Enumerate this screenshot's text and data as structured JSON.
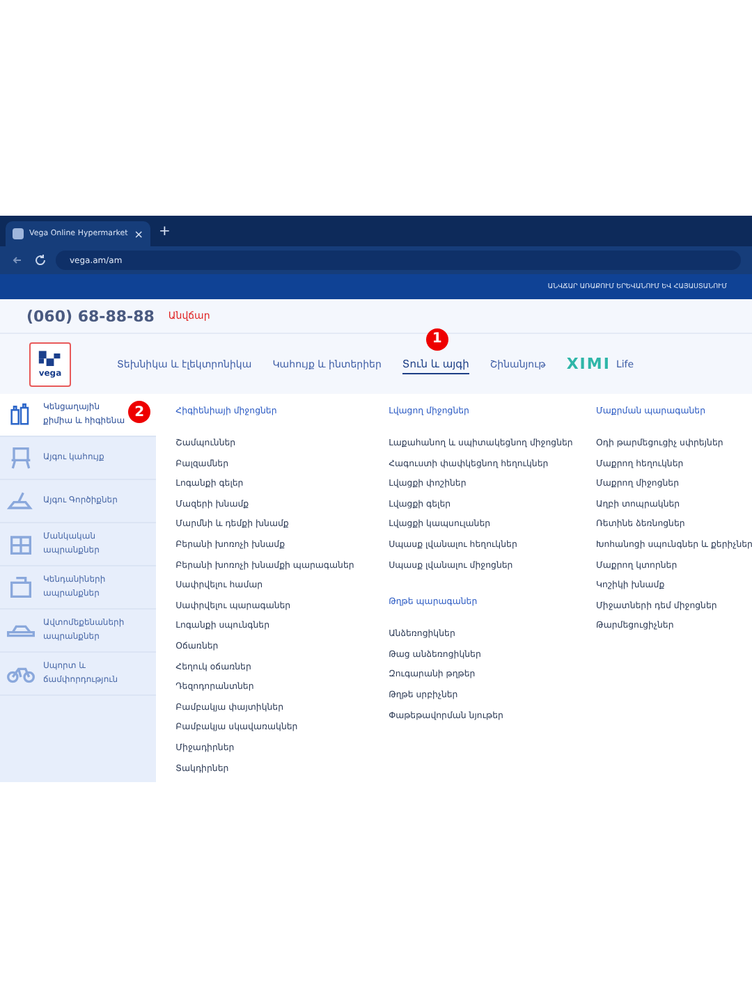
{
  "browser": {
    "tab_title": "Vega Online Hypermarket",
    "new_tab": "+",
    "close": "×",
    "url": "vega.am/am"
  },
  "promo_bar": "ԱՆՎՃԱՐ ԱՌԱՔՈՒՄ ԵՐԵՎԱՆՈՒՄ ԵՎ ՀԱՅԱՍՏԱՆՈՒՄ",
  "header": {
    "phone": "(060) 68-88-88",
    "phone_note": "Անվճար"
  },
  "logo": "vega",
  "nav": [
    {
      "label": "Տեխնիկա և էլեկտրոնիկա",
      "selected": false
    },
    {
      "label": "Կահույք և ինտերիեր",
      "selected": false
    },
    {
      "label": "Տուն և այգի",
      "selected": true,
      "marker": "1"
    },
    {
      "label": "Շինանյութ",
      "selected": false
    },
    {
      "label": "Life",
      "selected": false,
      "brand": "XIMI"
    }
  ],
  "sidebar": [
    {
      "label": "Կենցաղային քիմիա և հիգիենա",
      "selected": true,
      "marker": "2"
    },
    {
      "label": "Այգու կահույք",
      "selected": false
    },
    {
      "label": "Այգու Գործիքներ",
      "selected": false
    },
    {
      "label": "Մանկական ապրանքներ",
      "selected": false
    },
    {
      "label": "Կենդանիների ապրանքներ",
      "selected": false
    },
    {
      "label": "Ավտոմեքենաների ապրանքներ",
      "selected": false
    },
    {
      "label": "Սպորտ և ճամփորդություն",
      "selected": false
    }
  ],
  "columns": [
    [
      {
        "heading": "Հիգիենիայի միջոցներ",
        "items": [
          "Շամպուններ",
          "Բալզամներ",
          "Լոգանքի գելեր",
          "Մազերի խնամք",
          "Մարմնի և դեմքի խնամք",
          "Բերանի խոռոչի խնամք",
          "Բերանի խոռոչի խնամքի պարագաներ",
          "Սափրվելու համար",
          "Սափրվելու պարագաներ",
          "Լոգանքի սպունգներ",
          "Օճառներ",
          "Հեղուկ օճառներ",
          "Դեզոդորանտներ",
          "Բամբակյա փայտիկներ",
          "Բամբակյա սկավառակներ",
          "Միջադիրներ",
          "Տակդիրներ"
        ]
      }
    ],
    [
      {
        "heading": "Լվացող միջոցներ",
        "items": [
          "Լաքահանող և սպիտակեցնող միջոցներ",
          "Հագուստի փափկեցնող հեղուկներ",
          "Լվացքի փոշիներ",
          "Լվացքի գելեր",
          "Լվացքի կապսուլաներ",
          "Սպասք լվանալու հեղուկներ",
          "Սպասք լվանալու միջոցներ"
        ]
      },
      {
        "heading": "Թղթե պարագաներ",
        "items": [
          "Անձեռոցիկներ",
          "Թաց անձեռոցիկներ",
          "Զուգարանի թղթեր",
          "Թղթե սրբիչներ",
          "Փաթեթավորման նյութեր"
        ]
      }
    ],
    [
      {
        "heading": "Մաքրման պարագաներ",
        "items": [
          "Օդի թարմեցուցիչ սփրեյներ",
          "Մաքրող հեղուկներ",
          "Մաքրող միջոցներ",
          "Աղբի տոպրակներ",
          "Ռետինե ձեռնոցներ",
          "Խոհանոցի սպունգներ և քերիչներ",
          "Մաքրող կտորներ",
          "Կոշիկի խնամք",
          "Միջատների դեմ միջոցներ",
          "Թարմեցուցիչներ"
        ]
      }
    ]
  ]
}
